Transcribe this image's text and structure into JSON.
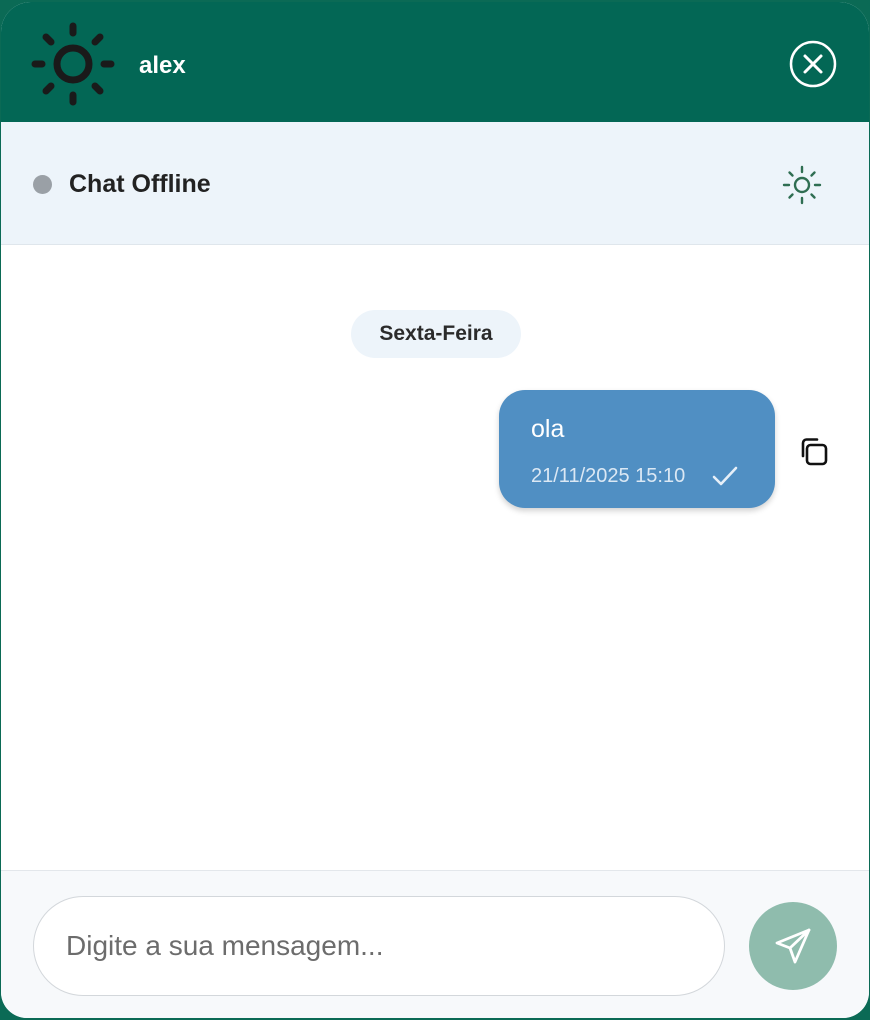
{
  "header": {
    "title": "alex",
    "logo_icon": "sun-gear-logo-icon",
    "close_icon": "close-circle-icon"
  },
  "status": {
    "text": "Chat Offline",
    "dot_color": "#9aa0a6",
    "action_icon": "sun-icon"
  },
  "conversation": {
    "date_label": "Sexta-Feira",
    "messages": [
      {
        "text": "ola",
        "time": "21/11/2025 15:10",
        "status_icon": "check-icon",
        "action_icon": "copy-icon"
      }
    ]
  },
  "composer": {
    "placeholder": "Digite a sua mensagem...",
    "value": "",
    "send_icon": "send-icon"
  },
  "colors": {
    "header_bg": "#036755",
    "status_bg": "#edf4fa",
    "bubble_bg": "#508fc3",
    "send_bg": "#8fbcad"
  }
}
